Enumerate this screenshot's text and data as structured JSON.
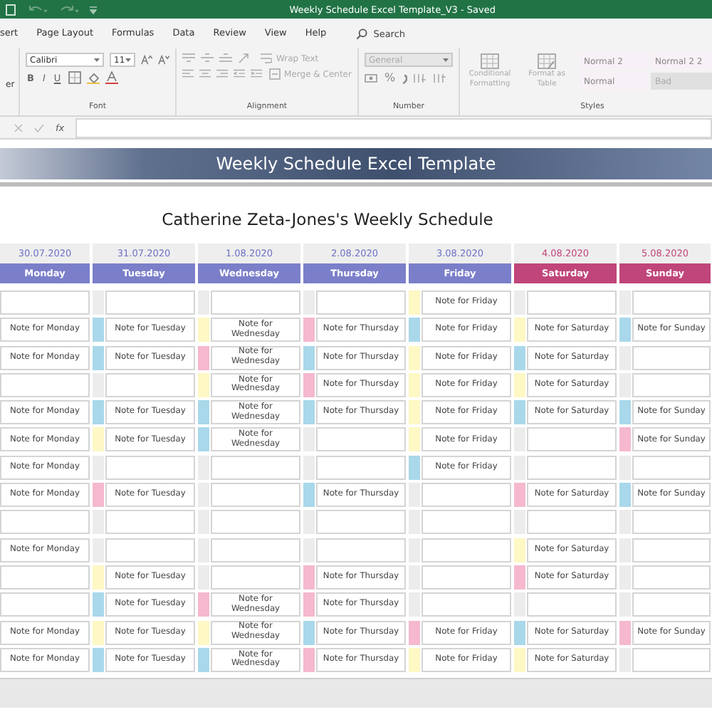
{
  "window": {
    "title": "Weekly Schedule Excel Template_V3  -  Saved"
  },
  "ribbon_tabs": [
    {
      "label": "sert",
      "selected": false
    },
    {
      "label": "Page Layout",
      "selected": false
    },
    {
      "label": "Formulas",
      "selected": false
    },
    {
      "label": "Data",
      "selected": false
    },
    {
      "label": "Review",
      "selected": false
    },
    {
      "label": "View",
      "selected": false
    },
    {
      "label": "Help",
      "selected": false
    }
  ],
  "search": {
    "placeholder": "Search"
  },
  "clipboard": {
    "label": "er"
  },
  "font_group": {
    "font": "Calibri",
    "size": "11",
    "bold": "B",
    "italic": "I",
    "underline": "U",
    "label": "Font"
  },
  "alignment_group": {
    "wrap_text": "Wrap Text",
    "merge": "Merge & Center",
    "label": "Alignment"
  },
  "number_group": {
    "format": "General",
    "percent": "%",
    "label": "Number"
  },
  "styles_group": {
    "conditional": "Conditional Formatting",
    "format_table": "Format as Table",
    "label": "Styles",
    "styles": [
      {
        "label": "Normal 2",
        "kind": "plain"
      },
      {
        "label": "Normal 2 2",
        "kind": "plain"
      },
      {
        "label": "Normal",
        "kind": "plain"
      },
      {
        "label": "Bad",
        "kind": "bad"
      }
    ]
  },
  "formula_bar": {
    "function_label": "fx"
  },
  "sheet": {
    "banner": "Weekly Schedule Excel Template",
    "heading": "Catherine Zeta-Jones's Weekly Schedule",
    "days": [
      {
        "date": "30.07.2020",
        "name": "Monday",
        "kind": "weekday"
      },
      {
        "date": "31.07.2020",
        "name": "Tuesday",
        "kind": "weekday"
      },
      {
        "date": "1.08.2020",
        "name": "Wednesday",
        "kind": "weekday"
      },
      {
        "date": "2.08.2020",
        "name": "Thursday",
        "kind": "weekday"
      },
      {
        "date": "3.08.2020",
        "name": "Friday",
        "kind": "weekday"
      },
      {
        "date": "4.08.2020",
        "name": "Saturday",
        "kind": "weekend"
      },
      {
        "date": "5.08.2020",
        "name": "Sunday",
        "kind": "weekend"
      }
    ],
    "rows": [
      {
        "cells": [
          {},
          {
            "color": "#ececec"
          },
          {
            "color": "#ececec"
          },
          {
            "color": "#ececec"
          },
          {
            "color": "#fdf8c4",
            "note": "Note for Friday"
          },
          {
            "color": "#ececec"
          },
          {
            "color": "#ececec"
          }
        ]
      },
      {
        "cells": [
          {
            "note": "Note for Monday"
          },
          {
            "color": "#a9d8ea",
            "note": "Note for Tuesday"
          },
          {
            "color": "#fdf8c4",
            "note": "Note for Wednesday"
          },
          {
            "color": "#f5b8cf",
            "note": "Note for Thursday"
          },
          {
            "color": "#a9d8ea",
            "note": "Note for Friday"
          },
          {
            "color": "#fdf8c4",
            "note": "Note for Saturday"
          },
          {
            "color": "#a9d8ea",
            "note": "Note for Sunday"
          }
        ]
      },
      {
        "cells": [
          {
            "note": "Note for Monday"
          },
          {
            "color": "#a9d8ea",
            "note": "Note for Tuesday"
          },
          {
            "color": "#f5b8cf",
            "note": "Note for Wednesday"
          },
          {
            "color": "#a9d8ea",
            "note": "Note for Thursday"
          },
          {
            "color": "#fdf8c4",
            "note": "Note for Friday"
          },
          {
            "color": "#a9d8ea",
            "note": "Note for Saturday"
          },
          {
            "color": "#ececec"
          }
        ]
      },
      {
        "cells": [
          {},
          {
            "color": "#ececec"
          },
          {
            "color": "#fdf8c4",
            "note": "Note for Wednesday"
          },
          {
            "color": "#f5b8cf",
            "note": "Note for Thursday"
          },
          {
            "color": "#fdf8c4",
            "note": "Note for Friday"
          },
          {
            "color": "#fdf8c4",
            "note": "Note for Saturday"
          },
          {
            "color": "#ececec"
          }
        ]
      },
      {
        "cells": [
          {
            "note": "Note for Monday"
          },
          {
            "color": "#a9d8ea",
            "note": "Note for Tuesday"
          },
          {
            "color": "#a9d8ea",
            "note": "Note for Wednesday"
          },
          {
            "color": "#a9d8ea",
            "note": "Note for Thursday"
          },
          {
            "color": "#fdf8c4",
            "note": "Note for Friday"
          },
          {
            "color": "#a9d8ea",
            "note": "Note for Saturday"
          },
          {
            "color": "#a9d8ea",
            "note": "Note for Sunday"
          }
        ]
      },
      {
        "cells": [
          {
            "note": "Note for Monday"
          },
          {
            "color": "#fdf8c4",
            "note": "Note for Tuesday"
          },
          {
            "color": "#a9d8ea",
            "note": "Note for Wednesday"
          },
          {
            "color": "#ececec"
          },
          {
            "color": "#fdf8c4",
            "note": "Note for Friday"
          },
          {
            "color": "#ececec"
          },
          {
            "color": "#f5b8cf",
            "note": "Note for Sunday"
          }
        ]
      },
      {
        "cells": [
          {
            "note": "Note for Monday"
          },
          {
            "color": "#ececec"
          },
          {
            "color": "#ececec"
          },
          {
            "color": "#ececec"
          },
          {
            "color": "#a9d8ea",
            "note": "Note for Friday"
          },
          {
            "color": "#ececec"
          },
          {
            "color": "#ececec"
          }
        ]
      },
      {
        "cells": [
          {
            "note": "Note for Monday"
          },
          {
            "color": "#f5b8cf",
            "note": "Note for Tuesday"
          },
          {
            "color": "#ececec"
          },
          {
            "color": "#a9d8ea",
            "note": "Note for Thursday"
          },
          {
            "color": "#ececec"
          },
          {
            "color": "#f5b8cf",
            "note": "Note for Saturday"
          },
          {
            "color": "#a9d8ea",
            "note": "Note for Sunday"
          }
        ]
      },
      {
        "cells": [
          {},
          {
            "color": "#ececec"
          },
          {
            "color": "#ececec"
          },
          {
            "color": "#ececec"
          },
          {
            "color": "#ececec"
          },
          {
            "color": "#ececec"
          },
          {
            "color": "#ececec"
          }
        ]
      },
      {
        "cells": [
          {
            "note": "Note for Monday"
          },
          {
            "color": "#ececec"
          },
          {
            "color": "#ececec"
          },
          {
            "color": "#ececec"
          },
          {
            "color": "#ececec"
          },
          {
            "color": "#fdf8c4",
            "note": "Note for Saturday"
          },
          {
            "color": "#ececec"
          }
        ]
      },
      {
        "cells": [
          {},
          {
            "color": "#fdf8c4",
            "note": "Note for Tuesday"
          },
          {
            "color": "#ececec"
          },
          {
            "color": "#f5b8cf",
            "note": "Note for Thursday"
          },
          {
            "color": "#ececec"
          },
          {
            "color": "#f5b8cf",
            "note": "Note for Saturday"
          },
          {
            "color": "#ececec"
          }
        ]
      },
      {
        "cells": [
          {},
          {
            "color": "#a9d8ea",
            "note": "Note for Tuesday"
          },
          {
            "color": "#f5b8cf",
            "note": "Note for Wednesday"
          },
          {
            "color": "#f5b8cf",
            "note": "Note for Thursday"
          },
          {
            "color": "#ececec"
          },
          {
            "color": "#ececec"
          },
          {
            "color": "#ececec"
          }
        ]
      },
      {
        "cells": [
          {
            "note": "Note for Monday"
          },
          {
            "color": "#fdf8c4",
            "note": "Note for Tuesday"
          },
          {
            "color": "#fdf8c4",
            "note": "Note for Wednesday"
          },
          {
            "color": "#a9d8ea",
            "note": "Note for Thursday"
          },
          {
            "color": "#f5b8cf",
            "note": "Note for Friday"
          },
          {
            "color": "#a9d8ea",
            "note": "Note for Saturday"
          },
          {
            "color": "#f5b8cf",
            "note": "Note for Sunday"
          }
        ]
      },
      {
        "cells": [
          {
            "note": "Note for Monday"
          },
          {
            "color": "#a9d8ea",
            "note": "Note for Tuesday"
          },
          {
            "color": "#a9d8ea",
            "note": "Note for Wednesday"
          },
          {
            "color": "#f5b8cf",
            "note": "Note for Thursday"
          },
          {
            "color": "#fdf8c4",
            "note": "Note for Friday"
          },
          {
            "color": "#fdf8c4",
            "note": "Note for Saturday"
          },
          {
            "color": "#ececec"
          }
        ]
      }
    ]
  }
}
